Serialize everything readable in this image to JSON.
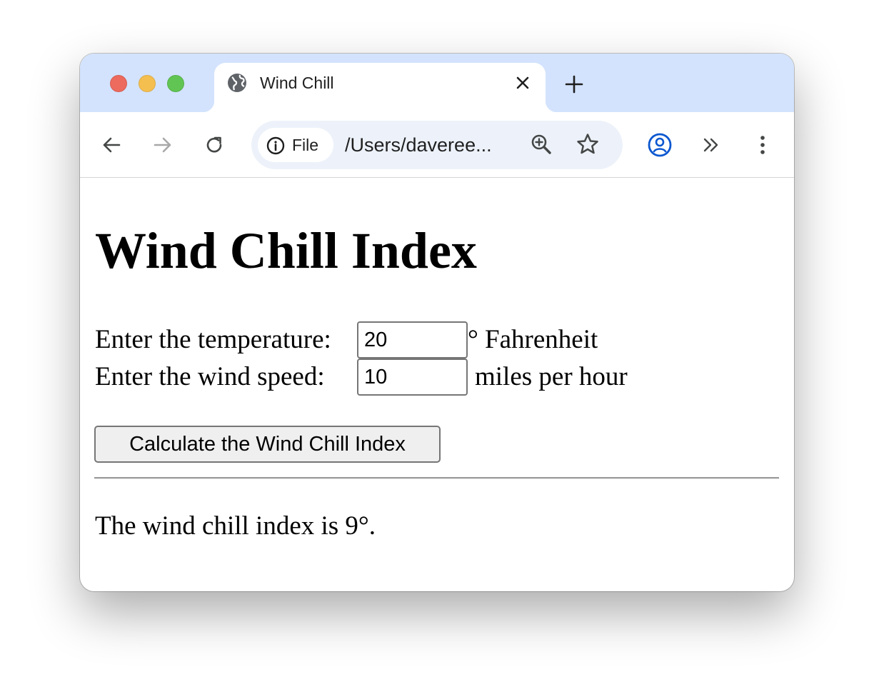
{
  "browser": {
    "tab_title": "Wind Chill",
    "chip_label": "File",
    "url": "/Users/daveree...",
    "tab_bg_color": "#d3e3fd",
    "omnibox_bg_color": "#edf2fa",
    "icons": {
      "favicon": "globe-icon",
      "close": "close-icon",
      "new_tab": "plus-icon",
      "back": "arrow-left-icon",
      "forward": "arrow-right-icon",
      "reload": "reload-icon",
      "site_info": "info-icon",
      "zoom": "zoom-in-icon",
      "bookmark": "star-icon",
      "profile": "profile-icon",
      "extensions": "chevrons-right-icon",
      "menu": "kebab-menu-icon"
    }
  },
  "page": {
    "heading": "Wind Chill Index",
    "temperature": {
      "label": "Enter the temperature:",
      "value": "20",
      "unit": "° Fahrenheit"
    },
    "wind_speed": {
      "label": "Enter the wind speed:",
      "value": "10",
      "unit": "miles per hour"
    },
    "button_label": "Calculate the Wind Chill Index",
    "result": "The wind chill index is 9°."
  }
}
